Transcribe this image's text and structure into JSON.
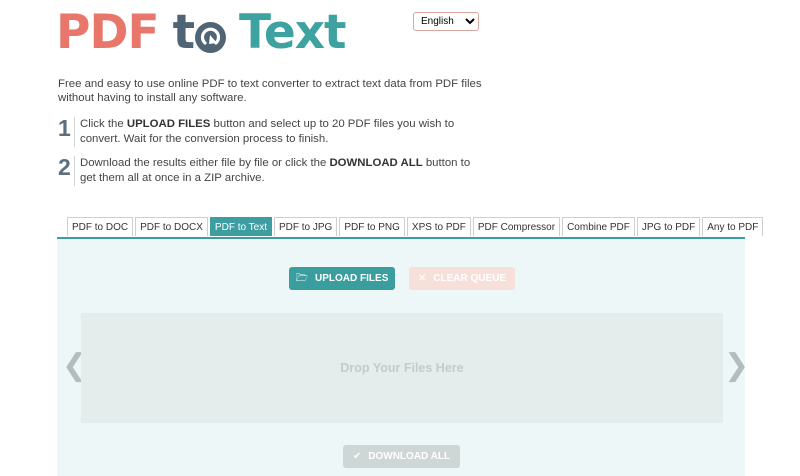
{
  "logo": {
    "part1": "PDF",
    "part2_t": "t",
    "part3": "Text"
  },
  "language": {
    "selected": "English",
    "options": [
      "English"
    ]
  },
  "intro": "Free and easy to use online PDF to text converter to extract text data from PDF files without having to install any software.",
  "steps": [
    {
      "number": "1",
      "pre": "Click the ",
      "bold": "UPLOAD FILES",
      "post": " button and select up to 20 PDF files you wish to convert. Wait for the conversion process to finish."
    },
    {
      "number": "2",
      "pre": "Download the results either file by file or click the ",
      "bold": "DOWNLOAD ALL",
      "post": " button to get them all at once in a ZIP archive."
    }
  ],
  "tabs": [
    {
      "label": "PDF to DOC",
      "active": false
    },
    {
      "label": "PDF to DOCX",
      "active": false
    },
    {
      "label": "PDF to Text",
      "active": true
    },
    {
      "label": "PDF to JPG",
      "active": false
    },
    {
      "label": "PDF to PNG",
      "active": false
    },
    {
      "label": "XPS to PDF",
      "active": false
    },
    {
      "label": "PDF Compressor",
      "active": false
    },
    {
      "label": "Combine PDF",
      "active": false
    },
    {
      "label": "JPG to PDF",
      "active": false
    },
    {
      "label": "Any to PDF",
      "active": false
    }
  ],
  "upload": {
    "upload_label": "UPLOAD FILES",
    "clear_label": "CLEAR QUEUE",
    "drop_label": "Drop Your Files Here",
    "download_label": "DOWNLOAD ALL"
  },
  "arrows": {
    "left": "❮",
    "right": "❯"
  },
  "colors": {
    "accent": "#3c9ea0",
    "logo_red": "#e8766b",
    "logo_dark": "#4f6474",
    "logo_teal": "#3ea3a0"
  }
}
